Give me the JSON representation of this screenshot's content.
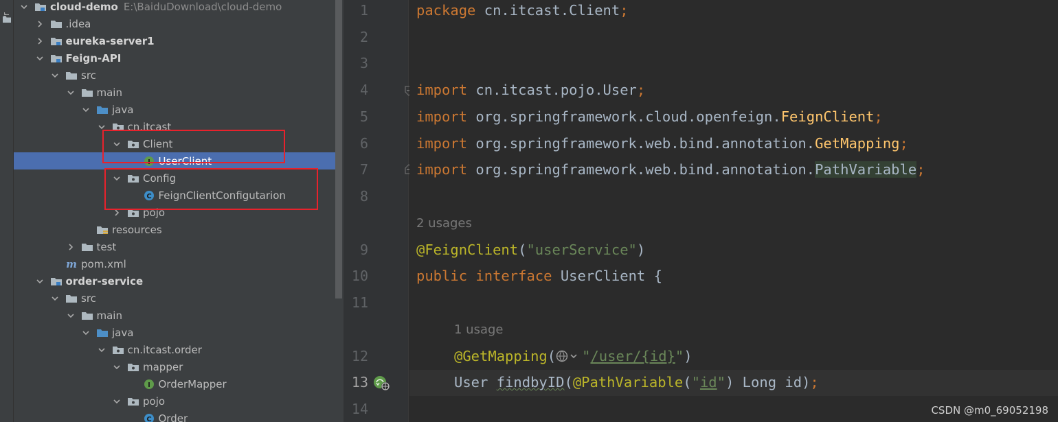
{
  "tool_window": {
    "label": "Pr"
  },
  "tree": [
    {
      "label": "cloud-demo",
      "path": "E:\\BaiduDownload\\cloud-demo",
      "bold": true,
      "icon": "module-folder-icon",
      "arrow": "down"
    },
    {
      "label": ".idea",
      "icon": "folder-icon",
      "arrow": "right"
    },
    {
      "label": "eureka-server1",
      "bold": true,
      "icon": "module-folder-icon",
      "arrow": "right"
    },
    {
      "label": "Feign-API",
      "bold": true,
      "icon": "module-folder-icon",
      "arrow": "down"
    },
    {
      "label": "src",
      "icon": "folder-icon",
      "arrow": "down"
    },
    {
      "label": "main",
      "icon": "folder-icon",
      "arrow": "down"
    },
    {
      "label": "java",
      "icon": "source-folder-icon",
      "arrow": "down"
    },
    {
      "label": "cn.itcast",
      "icon": "package-icon",
      "arrow": "down"
    },
    {
      "label": "Client",
      "icon": "package-icon",
      "arrow": "down"
    },
    {
      "label": "UserClient",
      "icon": "interface-icon",
      "arrow": "none",
      "selected": true
    },
    {
      "label": "Config",
      "icon": "package-icon",
      "arrow": "down"
    },
    {
      "label": "FeignClientConfigutarion",
      "icon": "class-icon",
      "arrow": "none"
    },
    {
      "label": "pojo",
      "icon": "package-icon",
      "arrow": "right"
    },
    {
      "label": "resources",
      "icon": "resources-folder-icon",
      "arrow": "none"
    },
    {
      "label": "test",
      "icon": "folder-icon",
      "arrow": "right"
    },
    {
      "label": "pom.xml",
      "icon": "maven-icon",
      "arrow": "none"
    },
    {
      "label": "order-service",
      "bold": true,
      "icon": "module-folder-icon",
      "arrow": "down"
    },
    {
      "label": "src",
      "icon": "folder-icon",
      "arrow": "down"
    },
    {
      "label": "main",
      "icon": "folder-icon",
      "arrow": "down"
    },
    {
      "label": "java",
      "icon": "source-folder-icon",
      "arrow": "down"
    },
    {
      "label": "cn.itcast.order",
      "icon": "package-icon",
      "arrow": "down"
    },
    {
      "label": "mapper",
      "icon": "package-icon",
      "arrow": "down"
    },
    {
      "label": "OrderMapper",
      "icon": "interface-icon",
      "arrow": "none"
    },
    {
      "label": "pojo",
      "icon": "package-icon",
      "arrow": "down"
    },
    {
      "label": "Order",
      "icon": "class-icon",
      "arrow": "none"
    }
  ],
  "tree_depths": [
    0,
    1,
    1,
    1,
    2,
    3,
    4,
    5,
    6,
    7,
    6,
    7,
    6,
    4,
    3,
    2,
    1,
    2,
    3,
    4,
    5,
    6,
    7,
    6,
    7
  ],
  "editor": {
    "line_numbers": [
      "1",
      "2",
      "3",
      "4",
      "5",
      "6",
      "7",
      "8",
      "9",
      "10",
      "11",
      "12",
      "13",
      "14"
    ],
    "current_line": "13",
    "lines": {
      "l1": {
        "kw": "package",
        "rest": " cn.itcast.Client",
        "semi": ";"
      },
      "l4": {
        "kw": "import",
        "rest": " cn.itcast.pojo.User",
        "semi": ";"
      },
      "l5": {
        "kw": "import",
        "pre": " org.springframework.cloud.openfeign.",
        "cls": "FeignClient",
        "semi": ";"
      },
      "l6": {
        "kw": "import",
        "pre": " org.springframework.web.bind.annotation.",
        "cls": "GetMapping",
        "semi": ";"
      },
      "l7": {
        "kw": "import",
        "pre": " org.springframework.web.bind.annotation.",
        "cls": "PathVariable",
        "semi": ";"
      },
      "usage1": "2 usages",
      "l9": {
        "ann": "@FeignClient",
        "open": "(",
        "str": "\"userService\"",
        "close": ")"
      },
      "l10": {
        "kw1": "public",
        "kw2": " interface",
        "rest": " UserClient {"
      },
      "usage2": "1 usage",
      "l12": {
        "ann": "@GetMapping",
        "open": "(",
        "q1": "\"",
        "path": "/user/{id}",
        "q2": "\"",
        "close": ")"
      },
      "l13": {
        "type": "User ",
        "method": "findbyID",
        "open": "(",
        "ann": "@PathVariable",
        "p1": "(",
        "q1": "\"",
        "id": "id",
        "q2": "\"",
        "rest": ") Long id)",
        "semi": ";"
      }
    }
  },
  "watermark": "CSDN @m0_69052198",
  "colors": {
    "keyword": "#cc7832",
    "annotation": "#bbb529",
    "string": "#6a8759",
    "selection": "#4b6eaf",
    "highlight_box": "#e8222c"
  }
}
